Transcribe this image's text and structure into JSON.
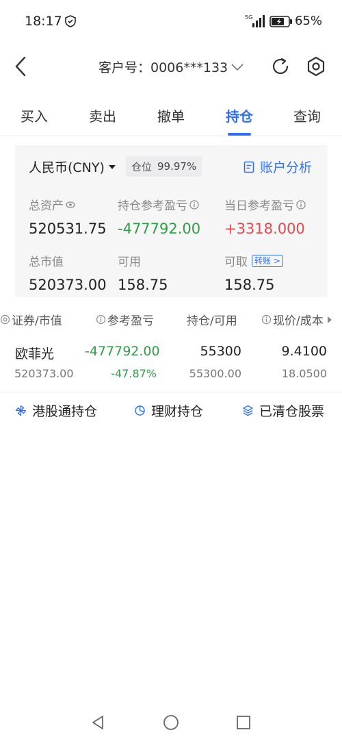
{
  "status_bar": {
    "time": "18:17",
    "network": "5G",
    "battery_percent": "65%"
  },
  "header": {
    "account_label": "客户号：0006***133",
    "icons": [
      "back-arrow-icon",
      "chevron-down-icon",
      "refresh-icon",
      "settings-icon"
    ]
  },
  "tabs": [
    {
      "label": "买入",
      "active": false
    },
    {
      "label": "卖出",
      "active": false
    },
    {
      "label": "撤单",
      "active": false
    },
    {
      "label": "持仓",
      "active": true
    },
    {
      "label": "查询",
      "active": false
    }
  ],
  "account_card": {
    "currency": "人民币(CNY)",
    "position_label": "仓位",
    "position_value": "99.97%",
    "analysis_link": "账户分析",
    "total_assets_label": "总资产",
    "total_assets": "520531.75",
    "holding_pnl_label": "持仓参考盈亏",
    "holding_pnl": "-477792.00",
    "daily_pnl_label": "当日参考盈亏",
    "daily_pnl": "+3318.000",
    "market_value_label": "总市值",
    "market_value": "520373.00",
    "available_label": "可用",
    "available": "158.75",
    "withdrawable_label": "可取",
    "withdrawable": "158.75",
    "transfer_badge": "转账 >"
  },
  "holdings_table": {
    "headers": [
      "证券/市值",
      "参考盈亏",
      "持仓/可用",
      "现价/成本"
    ],
    "rows": [
      {
        "name": "欧菲光",
        "market_value": "520373.00",
        "pnl": "-477792.00",
        "pnl_pct": "-47.87%",
        "position": "55300",
        "available": "55300.00",
        "price": "9.4100",
        "cost": "18.0500"
      }
    ]
  },
  "bottom_links": {
    "hk_connect": "港股通持仓",
    "wealth": "理财持仓",
    "cleared": "已清仓股票"
  },
  "colors": {
    "accent": "#2f6df5",
    "loss_green": "#2f9e44",
    "gain_red": "#e5484d"
  }
}
